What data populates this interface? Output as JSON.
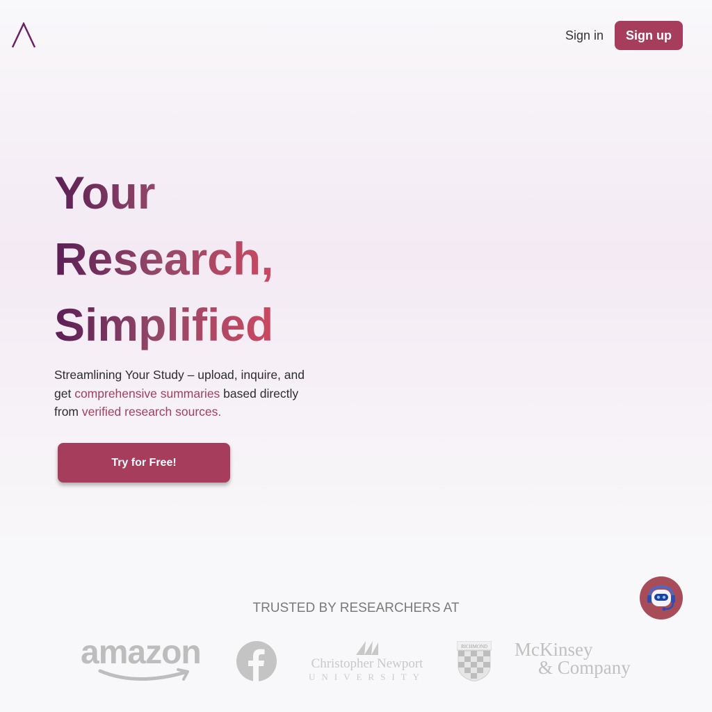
{
  "nav": {
    "logo_icon": "caret-logo",
    "sign_in": "Sign in",
    "sign_up": "Sign up"
  },
  "hero": {
    "headline_lines": [
      "Your",
      "Research,",
      "Simplified"
    ],
    "subtitle_part1": "Streamlining Your Study – upload, inquire, and get ",
    "subtitle_highlight1": "comprehensive summaries",
    "subtitle_part2": " based directly from ",
    "subtitle_highlight2": "verified research sources.",
    "cta": "Try for Free!"
  },
  "trusted": {
    "heading": "TRUSTED BY RESEARCHERS AT",
    "logos": {
      "amazon": "amazon",
      "cnu_name": "Christopher Newport",
      "cnu_univ": "UNIVERSITY",
      "richmond": "RICHMOND",
      "mckinsey_line1": "McKinsey",
      "mckinsey_line2": "& Company"
    }
  },
  "chat": {
    "icon": "robot-headset-icon"
  },
  "colors": {
    "accent": "#a63d5d",
    "gradient_start": "#5b1e55",
    "gradient_end": "#d04860",
    "logo_gray": "#bdbdbd"
  }
}
